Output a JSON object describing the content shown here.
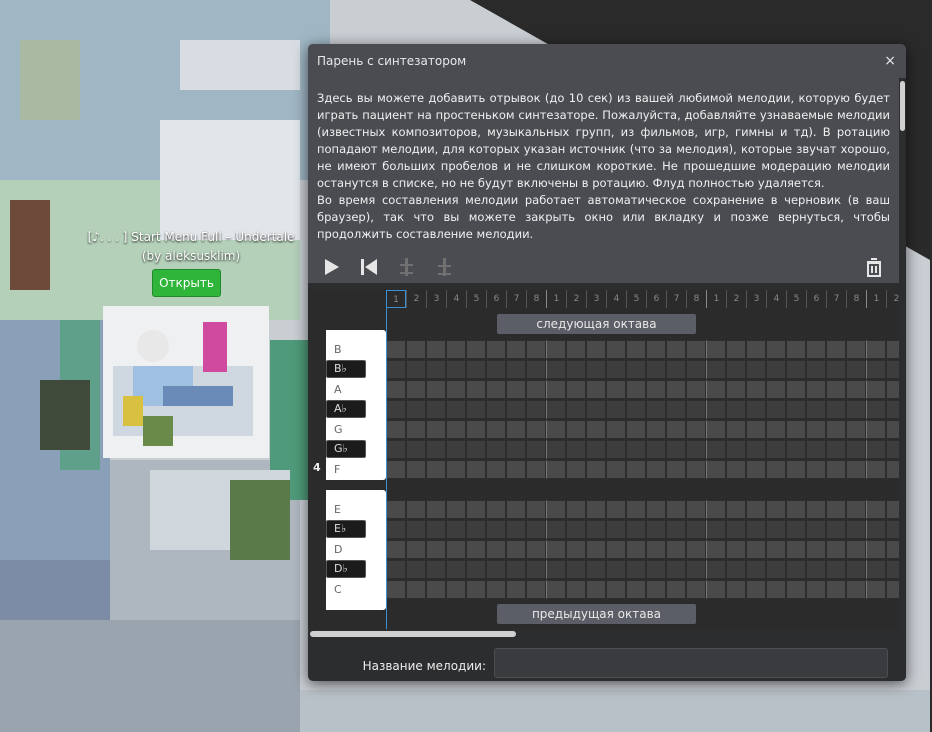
{
  "scene": {
    "track_info": "[♪. . . ] Start Menu Full – Undertale (by aleksusklim)",
    "open_button": "Открыть"
  },
  "dialog": {
    "title": "Парень с синтезатором",
    "close_icon": "×",
    "description": [
      "Здесь вы можете добавить отрывок (до 10 сек) из вашей любимой мелодии, которую будет играть пациент на простеньком синтезаторе. Пожалуйста, добавляйте узнаваемые мелодии (известных композиторов, музыкальных групп, из фильмов, игр, гимны и тд). В ротацию попадают мелодии, для которых указан источник (что за мелодия), которые звучат хорошо, не имеют больших пробелов и не слишком короткие. Не прошедшие модерацию мелодии останутся в списке, но не будут включены в ротацию. Флуд полностью удаляется.",
      "Во время составления мелодии работает автоматическое сохранение в черновик (в ваш браузер), так что вы можете закрыть окно или вкладку и позже вернуться, чтобы продолжить составление мелодии."
    ],
    "toolbar": {
      "play_icon": "play-icon",
      "restart_icon": "skip-back-icon",
      "delete_icon": "trash-icon"
    },
    "timeline_beats": [
      "1",
      "2",
      "3",
      "4",
      "5",
      "6",
      "7",
      "8",
      "1",
      "2",
      "3",
      "4",
      "5",
      "6",
      "7",
      "8",
      "1",
      "2",
      "3",
      "4",
      "5",
      "6",
      "7",
      "8",
      "1",
      "2"
    ],
    "next_octave": "следующая октава",
    "prev_octave": "предыдущая октава",
    "octave_number": "4",
    "keys_upper": [
      {
        "note": "B",
        "black": false
      },
      {
        "note": "B♭",
        "black": true
      },
      {
        "note": "A",
        "black": false
      },
      {
        "note": "A♭",
        "black": true
      },
      {
        "note": "G",
        "black": false
      },
      {
        "note": "G♭",
        "black": true
      },
      {
        "note": "F",
        "black": false
      }
    ],
    "keys_lower": [
      {
        "note": "E",
        "black": false
      },
      {
        "note": "E♭",
        "black": true
      },
      {
        "note": "D",
        "black": false
      },
      {
        "note": "D♭",
        "black": true
      },
      {
        "note": "C",
        "black": false
      }
    ],
    "melody_name_label": "Название мелодии:",
    "melody_name_value": ""
  },
  "colors": {
    "accent": "#3a8fd0",
    "open_button": "#2fb53a",
    "grid_white_row": "#4a4a4a",
    "grid_black_row": "#3d3d3d"
  }
}
